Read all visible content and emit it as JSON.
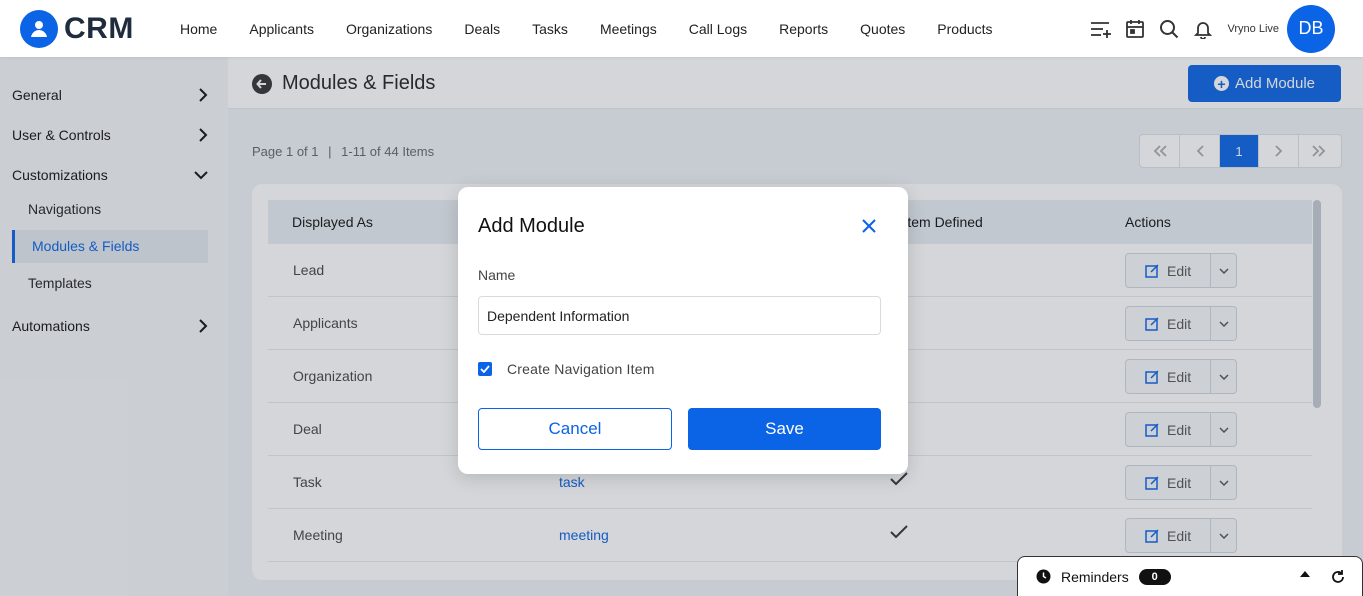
{
  "app": {
    "logo_text": "CRM"
  },
  "nav": [
    "Home",
    "Applicants",
    "Organizations",
    "Deals",
    "Tasks",
    "Meetings",
    "Call Logs",
    "Reports",
    "Quotes",
    "Products"
  ],
  "header_right": {
    "instance": "Vryno Live",
    "avatar": "DB"
  },
  "sidebar": {
    "general": "General",
    "users": "User & Controls",
    "customizations": "Customizations",
    "navigations": "Navigations",
    "modules": "Modules & Fields",
    "templates": "Templates",
    "automations": "Automations"
  },
  "page": {
    "title": "Modules & Fields",
    "add_module": "Add Module",
    "page_of": "Page 1 of 1",
    "items": "1-11 of 44 Items",
    "current_page": "1"
  },
  "table": {
    "headers": {
      "displayed_as": "Displayed As",
      "system_defined": "System Defined",
      "actions": "Actions"
    },
    "edit_label": "Edit",
    "rows": [
      {
        "displayed": "Lead",
        "name": ""
      },
      {
        "displayed": "Applicants",
        "name": ""
      },
      {
        "displayed": "Organization",
        "name": ""
      },
      {
        "displayed": "Deal",
        "name": ""
      },
      {
        "displayed": "Task",
        "name": "task"
      },
      {
        "displayed": "Meeting",
        "name": "meeting"
      }
    ]
  },
  "modal": {
    "title": "Add Module",
    "name_label": "Name",
    "name_value": "Dependent Information",
    "checkbox_label": "Create Navigation Item",
    "cancel": "Cancel",
    "save": "Save"
  },
  "reminders": {
    "label": "Reminders",
    "count": "0"
  },
  "colors": {
    "accent": "#0b63e5"
  }
}
